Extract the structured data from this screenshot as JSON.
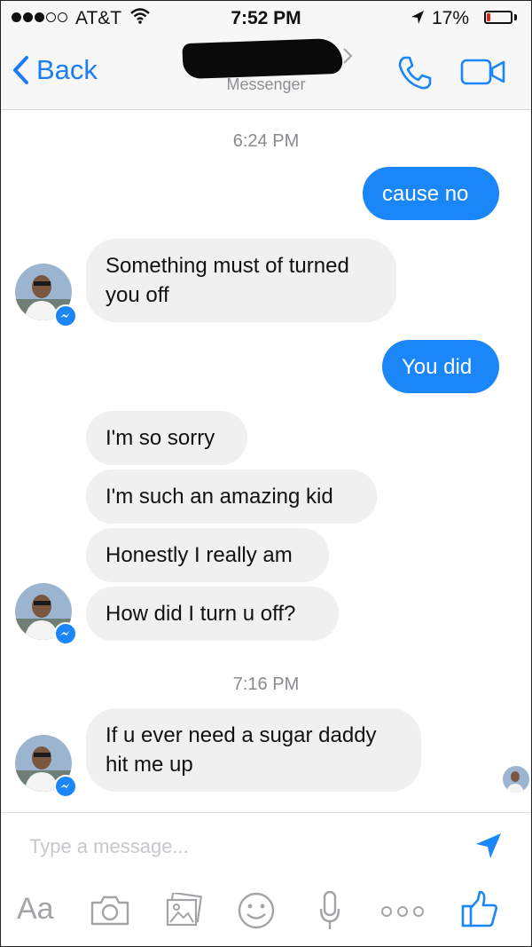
{
  "status_bar": {
    "carrier": "AT&T",
    "time": "7:52 PM",
    "battery_percent": "17%",
    "battery_level": 0.17,
    "signal_bars": 3,
    "signal_total": 5
  },
  "nav": {
    "back_label": "Back",
    "subtitle": "Messenger"
  },
  "conversation": {
    "timestamp_1": "6:24 PM",
    "msg_out_1": "cause no",
    "msg_in_1_line1": "Something must of turned",
    "msg_in_1_line2": "you off",
    "msg_out_2": "You did",
    "msg_in_2": "I'm so sorry",
    "msg_in_3": "I'm such an amazing kid",
    "msg_in_4": "Honestly I really am",
    "msg_in_5": "How did I turn u off?",
    "timestamp_2": "7:16 PM",
    "msg_in_6_line1": "If u ever need a sugar daddy",
    "msg_in_6_line2": "hit me up"
  },
  "composer": {
    "placeholder": "Type a message...",
    "aa_label": "Aa"
  },
  "colors": {
    "accent": "#1a86f7",
    "incoming_bubble": "#f1f0f0",
    "icon_gray": "#a4a4a8",
    "battery_low": "#e0231b"
  },
  "icons": [
    "wifi-icon",
    "location-arrow-icon",
    "battery-icon",
    "back-chevron-icon",
    "phone-icon",
    "video-camera-icon",
    "send-icon",
    "camera-icon",
    "gallery-icon",
    "emoji-icon",
    "microphone-icon",
    "more-icon",
    "thumbs-up-icon",
    "messenger-badge-icon"
  ]
}
